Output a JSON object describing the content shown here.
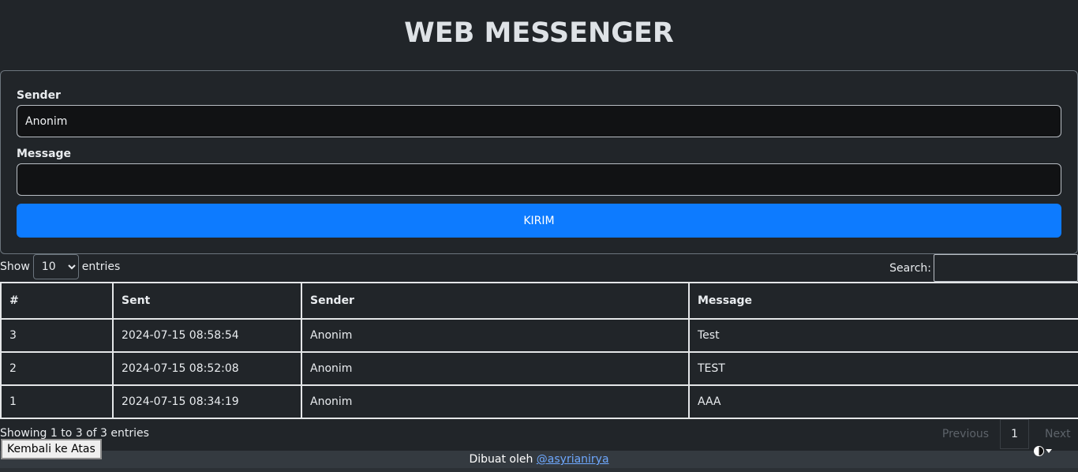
{
  "header": {
    "title": "WEB MESSENGER"
  },
  "form": {
    "sender_label": "Sender",
    "sender_value": "Anonim",
    "message_label": "Message",
    "message_value": "",
    "submit_label": "KIRIM"
  },
  "table_controls": {
    "show_label": "Show",
    "length_selected": "10",
    "entries_label": "entries",
    "search_label": "Search:",
    "search_value": ""
  },
  "table": {
    "columns": [
      "#",
      "Sent",
      "Sender",
      "Message"
    ],
    "rows": [
      [
        "3",
        "2024-07-15 08:58:54",
        "Anonim",
        "Test"
      ],
      [
        "2",
        "2024-07-15 08:52:08",
        "Anonim",
        "TEST"
      ],
      [
        "1",
        "2024-07-15 08:34:19",
        "Anonim",
        "AAA"
      ]
    ]
  },
  "table_info": "Showing 1 to 3 of 3 entries",
  "pagination": {
    "previous": "Previous",
    "current": "1",
    "next": "Next"
  },
  "back_to_top": "Kembali ke Atas",
  "footer": {
    "text": "Dibuat oleh",
    "link_text": "@asyrianirya"
  },
  "colors": {
    "background": "#212529",
    "accent": "#0d7bff",
    "footer_bg": "#343a40",
    "link": "#6ea8fe"
  },
  "icons": {
    "theme_toggle": "half-circle-contrast-icon"
  }
}
